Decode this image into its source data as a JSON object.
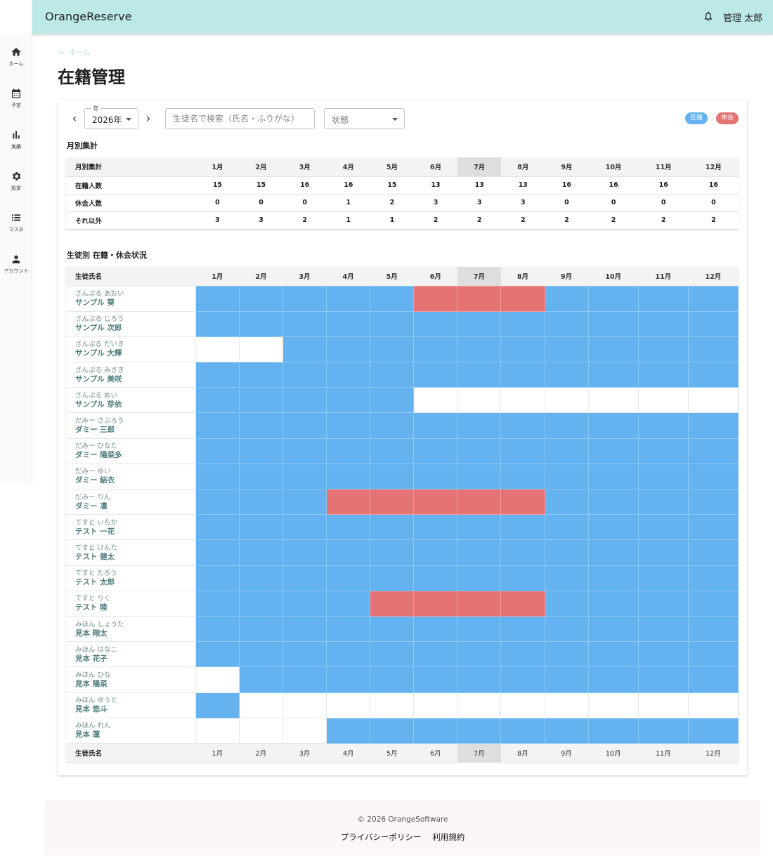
{
  "app": {
    "title": "OrangeReserve",
    "user_name": "管理 太郎"
  },
  "nav": [
    {
      "label": "ホーム",
      "icon": "home-icon"
    },
    {
      "label": "予定",
      "icon": "calendar-icon"
    },
    {
      "label": "実績",
      "icon": "bar-chart-icon"
    },
    {
      "label": "設定",
      "icon": "gear-icon"
    },
    {
      "label": "マスタ",
      "icon": "list-icon"
    },
    {
      "label": "アカウント",
      "icon": "person-icon"
    }
  ],
  "breadcrumb": {
    "label": "ホーム"
  },
  "page": {
    "title": "在籍管理"
  },
  "filters": {
    "year_label": "年",
    "year_value": "2026年",
    "search_placeholder": "生徒名で検索（氏名・ふりがな）",
    "status_placeholder": "状態"
  },
  "legend": {
    "enrolled": "在籍",
    "leave": "休会"
  },
  "colors": {
    "enrolled": "#64b3f0",
    "leave": "#e57374",
    "appbar": "#bde8e8",
    "current_month": "#dedede"
  },
  "months": [
    "1月",
    "2月",
    "3月",
    "4月",
    "5月",
    "6月",
    "7月",
    "8月",
    "9月",
    "10月",
    "11月",
    "12月"
  ],
  "current_month_index": 6,
  "monthly_summary": {
    "title": "月別集計",
    "header": "月別集計",
    "rows": [
      {
        "label": "在籍人数",
        "values": [
          "15",
          "15",
          "16",
          "16",
          "15",
          "13",
          "13",
          "13",
          "16",
          "16",
          "16",
          "16"
        ]
      },
      {
        "label": "休会人数",
        "values": [
          "0",
          "0",
          "0",
          "1",
          "2",
          "3",
          "3",
          "3",
          "0",
          "0",
          "0",
          "0"
        ]
      },
      {
        "label": "それ以外",
        "values": [
          "3",
          "3",
          "2",
          "1",
          "1",
          "2",
          "2",
          "2",
          "2",
          "2",
          "2",
          "2"
        ]
      }
    ]
  },
  "student_status": {
    "title": "生徒別 在籍・休会状況",
    "name_header": "生徒氏名",
    "footer_label": "生徒氏名",
    "students": [
      {
        "kana": "さんぷる あおい",
        "name": "サンプル 葵",
        "status": "EEEEEBBBEEEE"
      },
      {
        "kana": "さんぷる じろう",
        "name": "サンプル 次郎",
        "status": "EEEEEEEEEEEE"
      },
      {
        "kana": "さんぷる だいき",
        "name": "サンプル 大輝",
        "status": "NNEEEEEEEEEE"
      },
      {
        "kana": "さんぷる みさき",
        "name": "サンプル 美咲",
        "status": "EEEEEEEEEEEE"
      },
      {
        "kana": "さんぷる めい",
        "name": "サンプル 芽依",
        "status": "EEEEENNNNNNN"
      },
      {
        "kana": "だみー さぶろう",
        "name": "ダミー 三郎",
        "status": "EEEEEEEEEEEE"
      },
      {
        "kana": "だみー ひなた",
        "name": "ダミー 陽菜多",
        "status": "EEEEEEEEEEEE"
      },
      {
        "kana": "だみー ゆい",
        "name": "ダミー 結衣",
        "status": "EEEEEEEEEEEE"
      },
      {
        "kana": "だみー りん",
        "name": "ダミー 凛",
        "status": "EEEBBBBBEEEE"
      },
      {
        "kana": "てすと いちか",
        "name": "テスト 一花",
        "status": "EEEEEEEEEEEE"
      },
      {
        "kana": "てすと けんた",
        "name": "テスト 健太",
        "status": "EEEEEEEEEEEE"
      },
      {
        "kana": "てすと たろう",
        "name": "テスト 太郎",
        "status": "EEEEEEEEEEEE"
      },
      {
        "kana": "てすと りく",
        "name": "テスト 陸",
        "status": "EEEEBBBBEEEE"
      },
      {
        "kana": "みほん しょうた",
        "name": "見本 翔太",
        "status": "EEEEEEEEEEEE"
      },
      {
        "kana": "みほん はなこ",
        "name": "見本 花子",
        "status": "EEEEEEEEEEEE"
      },
      {
        "kana": "みほん ひな",
        "name": "見本 陽菜",
        "status": "NEEEEEEEEEEE"
      },
      {
        "kana": "みほん ゆうと",
        "name": "見本 悠斗",
        "status": "ENNNNNNNNNNN"
      },
      {
        "kana": "みほん れん",
        "name": "見本 蓮",
        "status": "NNNEEEEEEEEE"
      }
    ]
  },
  "footer": {
    "copyright": "© 2026 OrangeSoftware",
    "links": [
      "プライバシーポリシー",
      "利用規約"
    ]
  }
}
